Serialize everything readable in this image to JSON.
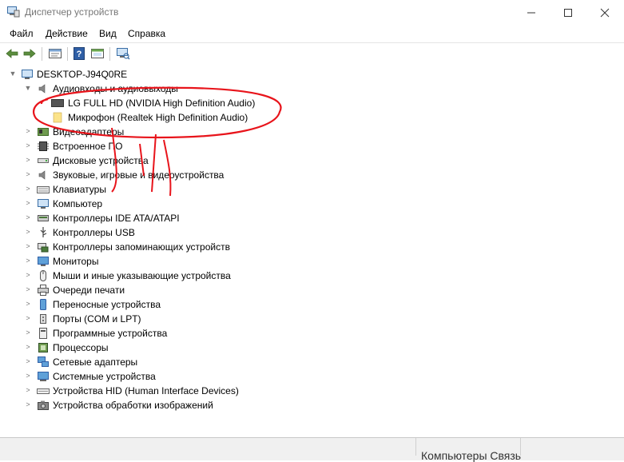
{
  "window": {
    "title": "Диспетчер устройств",
    "controls": {
      "minimize": "—",
      "maximize": "☐",
      "close": "✕"
    }
  },
  "menu": [
    "Файл",
    "Действие",
    "Вид",
    "Справка"
  ],
  "toolbar": {
    "icons": [
      "back-arrow-icon",
      "forward-arrow-icon",
      "properties-icon",
      "help-icon",
      "show-hidden-icon",
      "scan-hardware-icon"
    ]
  },
  "tree": {
    "root": "DESKTOP-J94Q0RE",
    "audio": {
      "label": "Аудиовходы и аудиовыходы",
      "children": [
        "LG FULL HD (NVIDIA High Definition Audio)",
        "Микрофон (Realtek High Definition Audio)"
      ]
    },
    "categories": [
      "Видеоадаптеры",
      "Встроенное ПО",
      "Дисковые устройства",
      "Звуковые, игровые и видеоустройства",
      "Клавиатуры",
      "Компьютер",
      "Контроллеры IDE ATA/ATAPI",
      "Контроллеры USB",
      "Контроллеры запоминающих устройств",
      "Мониторы",
      "Мыши и иные указывающие устройства",
      "Очереди печати",
      "Переносные устройства",
      "Порты (COM и LPT)",
      "Программные устройства",
      "Процессоры",
      "Сетевые адаптеры",
      "Системные устройства",
      "Устройства HID (Human Interface Devices)",
      "Устройства обработки изображений"
    ]
  },
  "bottom_partial_text": "Компьютеры Связь",
  "colors": {
    "annotation": "#e8141b",
    "window_bg": "#ffffff",
    "status_bg": "#f0f0f0"
  }
}
